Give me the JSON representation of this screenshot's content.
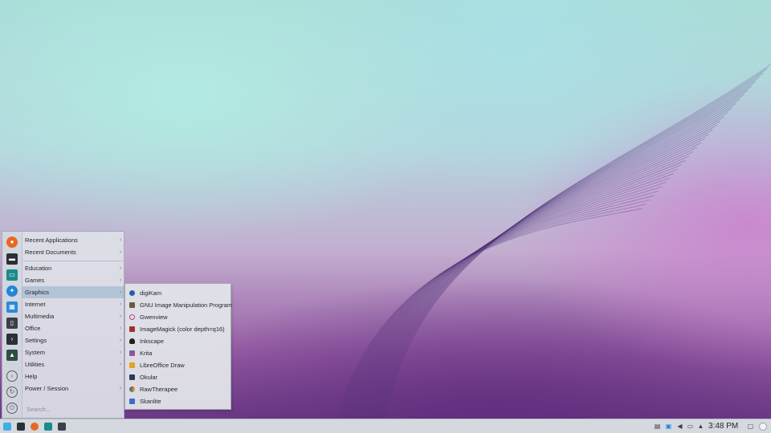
{
  "launcher": {
    "categories": [
      {
        "label": "Recent Applications",
        "has_submenu": true
      },
      {
        "label": "Recent Documents",
        "has_submenu": true
      },
      {
        "label": "Education",
        "has_submenu": true
      },
      {
        "label": "Games",
        "has_submenu": true
      },
      {
        "label": "Graphics",
        "has_submenu": true,
        "active": true
      },
      {
        "label": "Internet",
        "has_submenu": true
      },
      {
        "label": "Multimedia",
        "has_submenu": true
      },
      {
        "label": "Office",
        "has_submenu": true
      },
      {
        "label": "Settings",
        "has_submenu": true
      },
      {
        "label": "System",
        "has_submenu": true
      },
      {
        "label": "Utilities",
        "has_submenu": true
      },
      {
        "label": "Help",
        "has_submenu": false
      },
      {
        "label": "Power / Session",
        "has_submenu": true
      }
    ],
    "arrow_glyph": "›",
    "search_placeholder": "Search...",
    "favorites": [
      "firefox-icon",
      "terminal-icon",
      "file-manager-icon",
      "discover-icon",
      "calculator-icon",
      "document-viewer-icon",
      "konsole-icon",
      "system-monitor-icon"
    ],
    "power_actions": [
      "lock-screen-icon",
      "logout-icon",
      "shutdown-icon"
    ]
  },
  "graphics_submenu": {
    "items": [
      {
        "label": "digiKam",
        "icon": "digikam-icon",
        "color": "#2a5db0"
      },
      {
        "label": "GNU Image Manipulation Program",
        "icon": "gimp-icon",
        "color": "#6b5a40"
      },
      {
        "label": "Gwenview",
        "icon": "gwenview-icon",
        "color": "#c23a7a"
      },
      {
        "label": "ImageMagick (color depth=q16)",
        "icon": "imagemagick-icon",
        "color": "#a03030"
      },
      {
        "label": "Inkscape",
        "icon": "inkscape-icon",
        "color": "#222222"
      },
      {
        "label": "Krita",
        "icon": "krita-icon",
        "color": "#3a72c4"
      },
      {
        "label": "LibreOffice Draw",
        "icon": "libreoffice-draw-icon",
        "color": "#e8a21c"
      },
      {
        "label": "Okular",
        "icon": "okular-icon",
        "color": "#2d3a5a"
      },
      {
        "label": "RawTherapee",
        "icon": "rawtherapee-icon",
        "color": "#d83f2f"
      },
      {
        "label": "Skanlite",
        "icon": "skanlite-icon",
        "color": "#3a6fc4"
      }
    ]
  },
  "taskbar": {
    "launchers": [
      "kde-launcher-icon",
      "terminal-icon",
      "firefox-icon",
      "file-manager-icon",
      "screenshot-icon"
    ],
    "tray": [
      "clipboard-icon",
      "network-icon",
      "volume-icon",
      "display-icon",
      "expand-tray-icon"
    ],
    "clock": "3:48 PM",
    "show_desktop": "show-desktop-icon",
    "extra": "activity-icon"
  },
  "colors": {
    "accent": "#3daee9",
    "menu_bg": "#dee2e8",
    "active_row": "#93b0cc"
  }
}
